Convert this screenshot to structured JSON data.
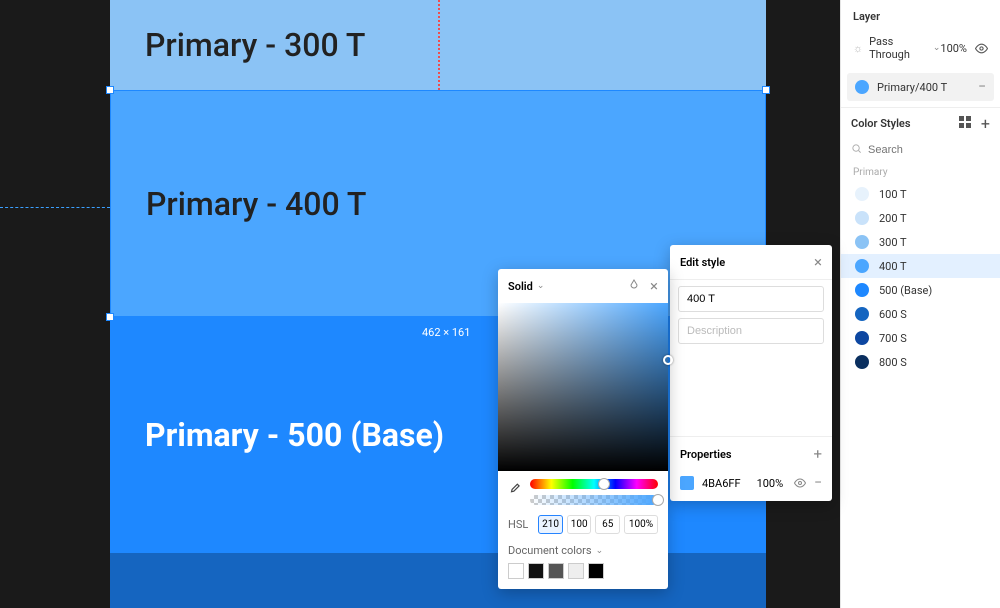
{
  "canvas": {
    "swatch300": {
      "label": "Primary - 300 T",
      "color": "#8bc3f5"
    },
    "swatch400": {
      "label": "Primary - 400 T",
      "color": "#4ba6ff"
    },
    "swatch500": {
      "label": "Primary - 500 (Base)",
      "color": "#1e88ff"
    },
    "swatch600": {
      "color": "#1565c0"
    },
    "dimension": "462 × 161"
  },
  "layer": {
    "title": "Layer",
    "blend_mode": "Pass Through",
    "opacity": "100%"
  },
  "selected_style": {
    "name": "Primary/400 T",
    "color": "#4ba6ff"
  },
  "color_styles": {
    "title": "Color Styles",
    "search_placeholder": "Search",
    "group": "Primary",
    "items": [
      {
        "name": "100 T",
        "color": "#e7f2fc"
      },
      {
        "name": "200 T",
        "color": "#c9e2fa"
      },
      {
        "name": "300 T",
        "color": "#8bc3f5"
      },
      {
        "name": "400 T",
        "color": "#4ba6ff",
        "active": true
      },
      {
        "name": "500 (Base)",
        "color": "#1e88ff"
      },
      {
        "name": "600 S",
        "color": "#1565c0"
      },
      {
        "name": "700 S",
        "color": "#0d47a1"
      },
      {
        "name": "800 S",
        "color": "#0a2f5f"
      }
    ]
  },
  "edit_style": {
    "title": "Edit style",
    "name_value": "400 T",
    "desc_placeholder": "Description",
    "props_title": "Properties",
    "prop_hex": "4BA6FF",
    "prop_opacity": "100%",
    "swatch": "#4ba6ff"
  },
  "color_picker": {
    "mode": "Solid",
    "hsl_label": "HSL",
    "h": "210",
    "s": "100",
    "l": "65",
    "a": "100%",
    "doc_colors_label": "Document colors",
    "doc_swatches": [
      "#ffffff",
      "#111111",
      "#555555",
      "#eeeeee",
      "#000000"
    ]
  }
}
